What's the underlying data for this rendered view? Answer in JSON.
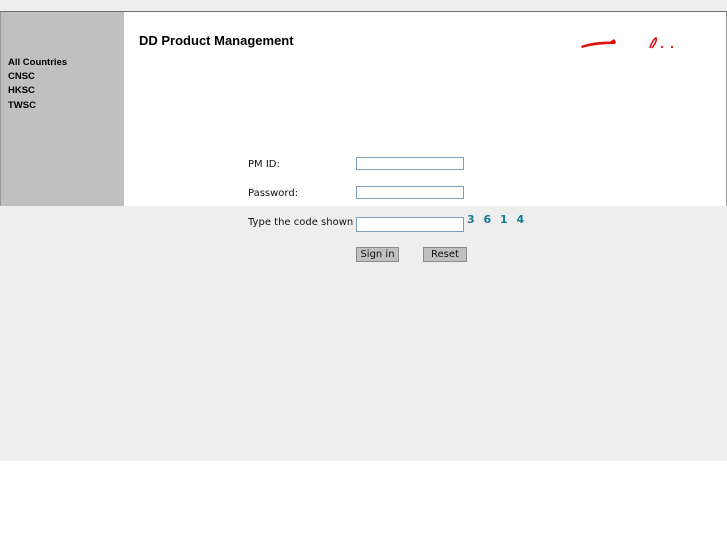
{
  "header": {
    "title": "DD Product Management"
  },
  "sidebar": {
    "items": [
      {
        "label": "All Countries"
      },
      {
        "label": "CNSC"
      },
      {
        "label": "HKSC"
      },
      {
        "label": "TWSC"
      }
    ]
  },
  "login_form": {
    "pm_id": {
      "label": "PM ID:",
      "value": ""
    },
    "password": {
      "label": "Password:",
      "value": ""
    },
    "captcha": {
      "label": "Type the code shown",
      "value": "",
      "code": "3 6 1 4"
    },
    "sign_in_label": "Sign in",
    "reset_label": "Reset"
  },
  "colors": {
    "sidebar_bg": "#c0c0c0",
    "panel_bg": "#eeeeee",
    "captcha_text": "#167a93",
    "logo_red": "#e01010"
  }
}
